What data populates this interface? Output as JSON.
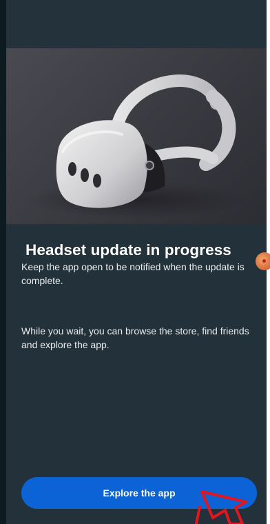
{
  "screen": {
    "title": "Headset update in progress",
    "paragraphs": [
      "Keep the app open to be notified when the update is complete.",
      "While you wait, you can browse the store, find friends and explore the app."
    ],
    "primary_button_label": "Explore the app"
  },
  "hero_image": {
    "subject": "VR headset"
  },
  "colors": {
    "panel_background": "#23323a",
    "primary_button": "#0b63d6",
    "annotation_arrow": "#e3161f"
  },
  "icons": {
    "hero": "vr-headset-illustration",
    "side_bubble": "floating-chat-bubble-icon",
    "annotation": "red-arrow-pointer-icon"
  }
}
